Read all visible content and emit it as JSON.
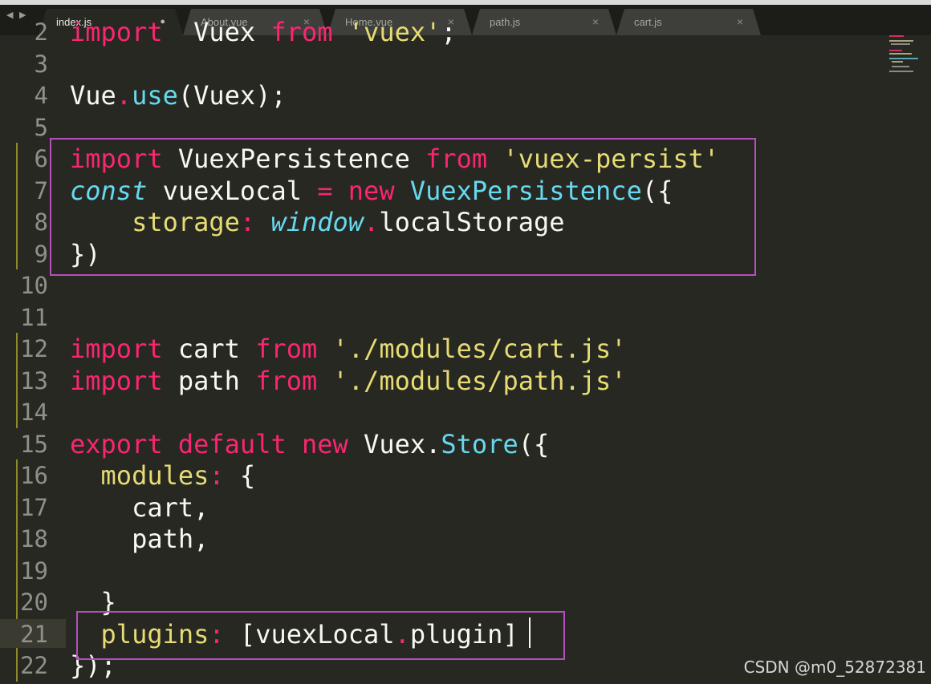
{
  "tabs": [
    {
      "label": "index.js",
      "active": true,
      "modified": true
    },
    {
      "label": "About.vue",
      "active": false
    },
    {
      "label": "Home.vue",
      "active": false
    },
    {
      "label": "path.js",
      "active": false
    },
    {
      "label": "cart.js",
      "active": false
    }
  ],
  "icons": {
    "nav": "nav-arrows-icon",
    "close": "close-icon",
    "modified": "modified-dot-icon"
  },
  "colors": {
    "keyword": "#f92672",
    "string": "#e6db74",
    "function": "#66d9ef",
    "highlight_box": "#b54fbd",
    "background": "#272822"
  },
  "editor": {
    "current_line": "21",
    "lines": [
      {
        "num": "2",
        "tokens": [
          [
            "kw",
            "import"
          ],
          [
            "",
            "  Vuex "
          ],
          [
            "kw",
            "from"
          ],
          [
            "st",
            " 'vuex'"
          ],
          [
            "",
            ";"
          ]
        ]
      },
      {
        "num": "3",
        "tokens": []
      },
      {
        "num": "4",
        "tokens": [
          [
            "",
            "Vue"
          ],
          [
            "pu",
            "."
          ],
          [
            "fn",
            "use"
          ],
          [
            "",
            "(Vuex);"
          ]
        ]
      },
      {
        "num": "5",
        "tokens": []
      },
      {
        "num": "6",
        "tokens": [
          [
            "kw",
            "import"
          ],
          [
            "",
            " VuexPersistence "
          ],
          [
            "kw",
            "from"
          ],
          [
            "",
            " "
          ],
          [
            "st",
            "'vuex-persist'"
          ]
        ]
      },
      {
        "num": "7",
        "tokens": [
          [
            "it",
            "const"
          ],
          [
            "",
            " vuexLocal "
          ],
          [
            "kw",
            "="
          ],
          [
            "",
            " "
          ],
          [
            "kw",
            "new"
          ],
          [
            "",
            " "
          ],
          [
            "fn",
            "VuexPersistence"
          ],
          [
            "",
            "({"
          ]
        ]
      },
      {
        "num": "8",
        "tokens": [
          [
            "",
            "    "
          ],
          [
            "pr",
            "storage"
          ],
          [
            "pu",
            ":"
          ],
          [
            "",
            " "
          ],
          [
            "it",
            "window"
          ],
          [
            "pu",
            "."
          ],
          [
            "",
            "localStorage"
          ]
        ]
      },
      {
        "num": "9",
        "tokens": [
          [
            "",
            "})"
          ]
        ]
      },
      {
        "num": "10",
        "tokens": []
      },
      {
        "num": "11",
        "tokens": []
      },
      {
        "num": "12",
        "tokens": [
          [
            "kw",
            "import"
          ],
          [
            "",
            " cart "
          ],
          [
            "kw",
            "from"
          ],
          [
            "",
            " "
          ],
          [
            "st",
            "'./modules/cart.js'"
          ]
        ]
      },
      {
        "num": "13",
        "tokens": [
          [
            "kw",
            "import"
          ],
          [
            "",
            " path "
          ],
          [
            "kw",
            "from"
          ],
          [
            "",
            " "
          ],
          [
            "st",
            "'./modules/path.js'"
          ]
        ]
      },
      {
        "num": "14",
        "tokens": []
      },
      {
        "num": "15",
        "tokens": [
          [
            "kw",
            "export"
          ],
          [
            "",
            " "
          ],
          [
            "kw",
            "default"
          ],
          [
            "",
            " "
          ],
          [
            "kw",
            "new"
          ],
          [
            "",
            " Vuex."
          ],
          [
            "fn",
            "Store"
          ],
          [
            "",
            "({"
          ]
        ]
      },
      {
        "num": "16",
        "tokens": [
          [
            "",
            "  "
          ],
          [
            "pr",
            "modules"
          ],
          [
            "pu",
            ":"
          ],
          [
            "",
            " {"
          ]
        ]
      },
      {
        "num": "17",
        "tokens": [
          [
            "",
            "    cart,"
          ]
        ]
      },
      {
        "num": "18",
        "tokens": [
          [
            "",
            "    path,"
          ]
        ]
      },
      {
        "num": "19",
        "tokens": []
      },
      {
        "num": "20",
        "tokens": [
          [
            "",
            "  }"
          ]
        ]
      },
      {
        "num": "21",
        "tokens": [
          [
            "",
            "  "
          ],
          [
            "pr",
            "plugins"
          ],
          [
            "pu",
            ":"
          ],
          [
            "",
            " [vuexLocal"
          ],
          [
            "pu",
            "."
          ],
          [
            "",
            "plugin]"
          ]
        ]
      },
      {
        "num": "22",
        "tokens": [
          [
            "",
            "});"
          ]
        ]
      }
    ]
  },
  "watermark": "CSDN @m0_52872381"
}
